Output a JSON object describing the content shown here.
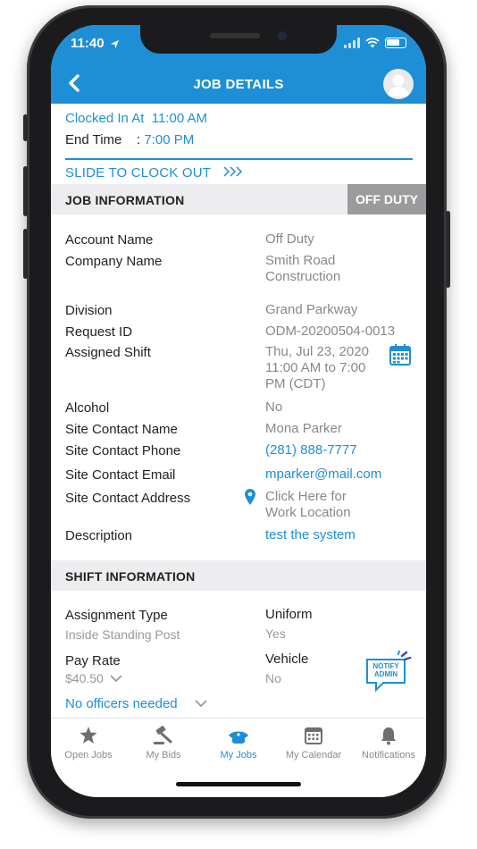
{
  "status_bar": {
    "time": "11:40"
  },
  "nav": {
    "title": "JOB DETAILS"
  },
  "clock": {
    "clocked_in_label": "Clocked In At",
    "clocked_in_value": "11:00 AM",
    "end_time_label": "End Time",
    "end_time_sep": ":",
    "end_time_value": "7:00 PM",
    "slide_label": "SLIDE TO CLOCK OUT"
  },
  "job_info": {
    "header": "JOB INFORMATION",
    "badge": "OFF DUTY",
    "rows": {
      "account_name": {
        "label": "Account Name",
        "value": "Off Duty"
      },
      "company_name": {
        "label": "Company Name",
        "value_line1": "Smith Road",
        "value_line2": "Construction"
      },
      "division": {
        "label": "Division",
        "value": "Grand Parkway"
      },
      "request_id": {
        "label": "Request ID",
        "value": "ODM-20200504-0013"
      },
      "assigned_shift": {
        "label": "Assigned Shift",
        "line1": "Thu, Jul 23, 2020",
        "line2": "11:00 AM to 7:00",
        "line3": "PM (CDT)"
      },
      "alcohol": {
        "label": "Alcohol",
        "value": "No"
      },
      "site_contact_name": {
        "label": "Site Contact Name",
        "value": "Mona Parker"
      },
      "site_contact_phone": {
        "label": "Site Contact Phone",
        "value": "(281) 888-7777"
      },
      "site_contact_email": {
        "label": "Site Contact Email",
        "value": "mparker@mail.com"
      },
      "site_contact_address": {
        "label": "Site Contact Address",
        "line1": "Click Here for",
        "line2": "Work Location"
      },
      "description": {
        "label": "Description",
        "value": "test the system"
      }
    }
  },
  "shift_info": {
    "header": "SHIFT INFORMATION",
    "assignment_type": {
      "label": "Assignment Type",
      "value": "Inside Standing Post"
    },
    "uniform": {
      "label": "Uniform",
      "value": "Yes"
    },
    "pay_rate": {
      "label": "Pay Rate",
      "value": "$40.50"
    },
    "vehicle": {
      "label": "Vehicle",
      "value": "No"
    },
    "officers": "No officers needed",
    "notify_line1": "NOTIFY",
    "notify_line2": "ADMIN"
  },
  "tabs": [
    {
      "label": "Open Jobs",
      "icon": "badge-star-icon"
    },
    {
      "label": "My Bids",
      "icon": "gavel-icon"
    },
    {
      "label": "My Jobs",
      "icon": "police-cap-icon"
    },
    {
      "label": "My Calendar",
      "icon": "calendar-icon"
    },
    {
      "label": "Notifications",
      "icon": "bell-icon"
    }
  ],
  "colors": {
    "primary": "#1e8fd6",
    "badge_gray": "#9b9b9e",
    "section_bg": "#ededf0"
  }
}
